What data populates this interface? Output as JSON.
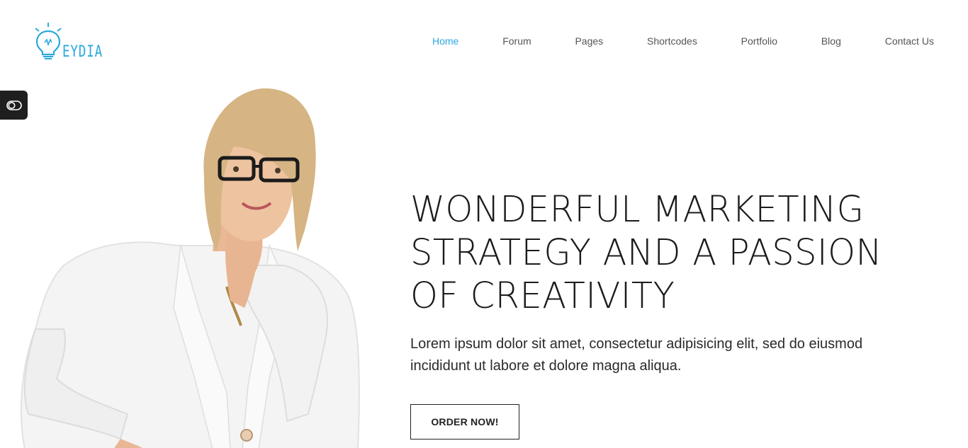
{
  "brand": {
    "name": "EYDIA",
    "accent_color": "#29a8de",
    "icon": "lightbulb-icon"
  },
  "nav": {
    "items": [
      {
        "label": "Home",
        "active": true
      },
      {
        "label": "Forum",
        "active": false
      },
      {
        "label": "Pages",
        "active": false
      },
      {
        "label": "Shortcodes",
        "active": false
      },
      {
        "label": "Portfolio",
        "active": false
      },
      {
        "label": "Blog",
        "active": false
      },
      {
        "label": "Contact Us",
        "active": false
      }
    ]
  },
  "side_toggle": {
    "icon": "toggle-switch-icon",
    "background": "#1f1f1f"
  },
  "hero": {
    "title_lines": [
      "WONDERFUL MARKETING",
      "STRATEGY AND A PASSION",
      "OF CREATIVITY"
    ],
    "description": "Lorem ipsum dolor sit amet, consectetur adipisicing elit, sed do eiusmod incididunt ut labore et dolore magna aliqua.",
    "cta_label": "ORDER NOW!",
    "image_subject": "woman-in-white-blazer"
  }
}
